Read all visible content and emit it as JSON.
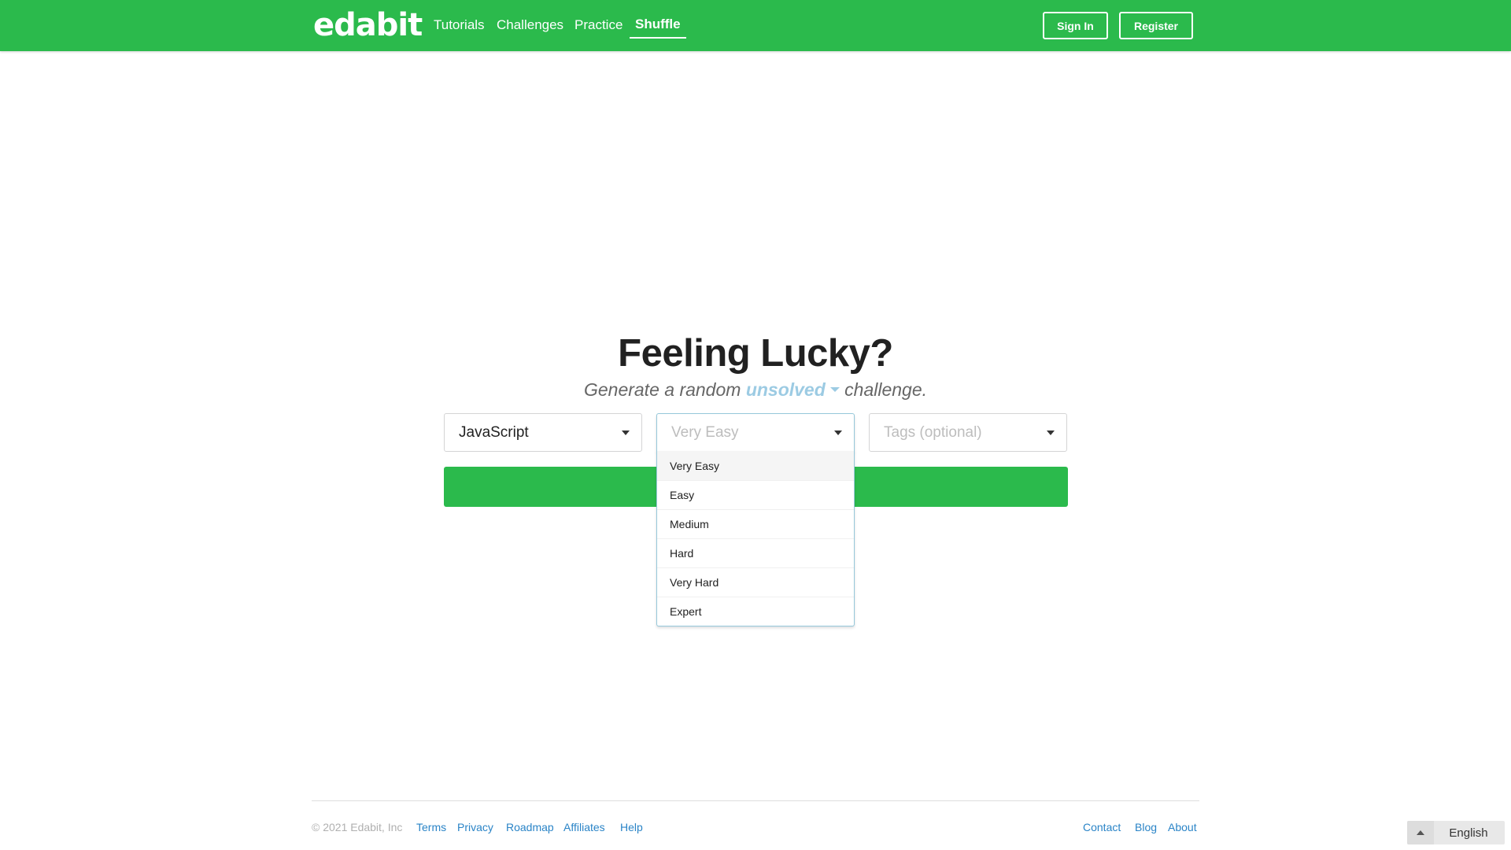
{
  "header": {
    "logo": "edabit",
    "nav": [
      {
        "label": "Tutorials"
      },
      {
        "label": "Challenges"
      },
      {
        "label": "Practice"
      },
      {
        "label": "Shuffle",
        "active": true
      }
    ],
    "signin_label": "Sign In",
    "register_label": "Register"
  },
  "main": {
    "title": "Feeling Lucky?",
    "subtitle_prefix": "Generate a random",
    "subtitle_filter": "unsolved",
    "subtitle_suffix": "challenge.",
    "language_select": {
      "value": "JavaScript"
    },
    "difficulty_select": {
      "placeholder": "Very Easy",
      "open": true,
      "options": [
        "Very Easy",
        "Easy",
        "Medium",
        "Hard",
        "Very Hard",
        "Expert"
      ],
      "highlighted": "Very Easy"
    },
    "tags_select": {
      "placeholder": "Tags (optional)"
    }
  },
  "footer": {
    "copyright": "© 2021 Edabit, Inc",
    "left_links": [
      "Terms",
      "Privacy",
      "Roadmap",
      "Affiliates",
      "Help"
    ],
    "right_links": [
      "Contact",
      "Blog",
      "About"
    ],
    "language": "English"
  },
  "colors": {
    "brand_green": "#2bba4c",
    "link_blue": "#2a84c7",
    "filter_blue": "#9ccbe3"
  }
}
